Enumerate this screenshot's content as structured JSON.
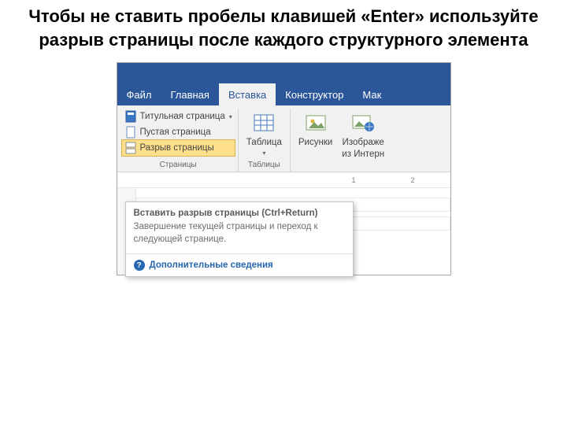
{
  "caption": "Чтобы не ставить пробелы клавишей «Enter» используйте разрыв страницы после каждого структурного элемента",
  "tabs": {
    "file": "Файл",
    "home": "Главная",
    "insert": "Вставка",
    "design": "Конструктор",
    "layout": "Мак"
  },
  "pages_group": {
    "cover": "Титульная страница",
    "blank": "Пустая страница",
    "break": "Разрыв страницы",
    "label": "Страницы"
  },
  "tables_group": {
    "table": "Таблица",
    "label": "Таблицы"
  },
  "illus_group": {
    "pictures": "Рисунки",
    "online": "Изображе",
    "online2": "из Интерн"
  },
  "ruler": {
    "one": "1",
    "two": "2"
  },
  "tooltip": {
    "title": "Вставить разрыв страницы (Ctrl+Return)",
    "body": "Завершение текущей страницы и переход к следующей странице.",
    "more": "Дополнительные сведения"
  }
}
